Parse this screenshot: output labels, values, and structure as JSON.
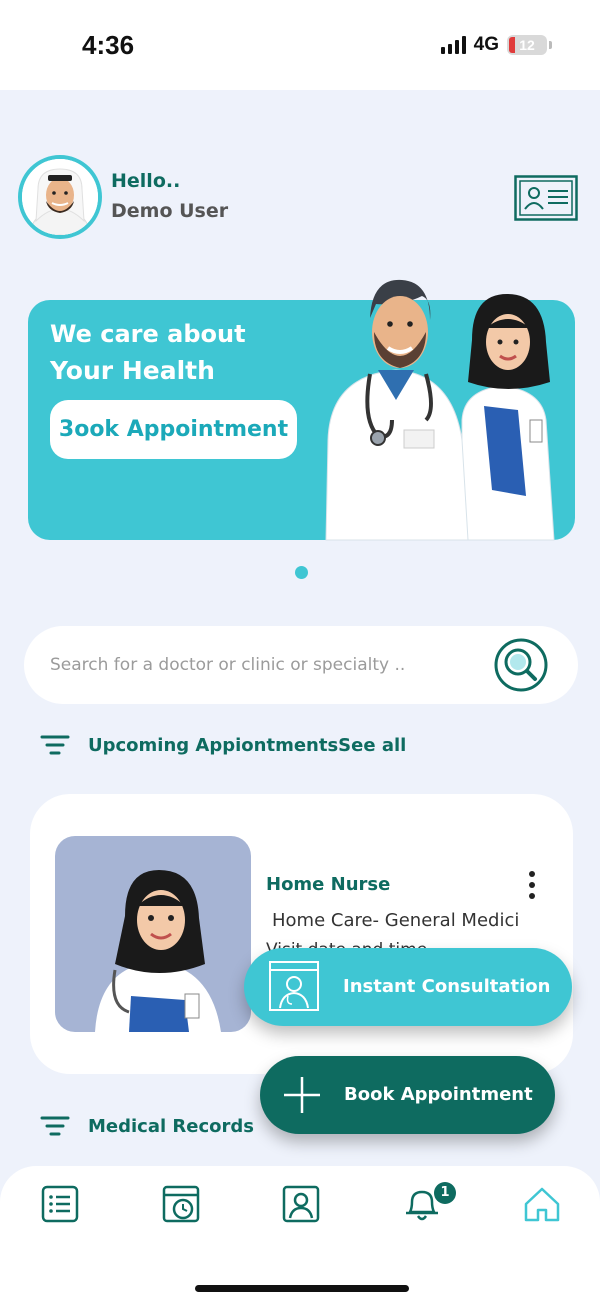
{
  "status": {
    "time": "4:36",
    "network": "4G",
    "battery": "12"
  },
  "greeting": {
    "hello": "Hello..",
    "name": "Demo User"
  },
  "banner": {
    "line1": "We care about",
    "line2": "Your Health",
    "button": "3ook Appointment"
  },
  "search": {
    "placeholder": "Search for a doctor or clinic or specialty .."
  },
  "sections": {
    "upcoming": "Upcoming AppiontmentsSee all",
    "records": "Medical Records"
  },
  "appointment": {
    "type": "Home Nurse",
    "service": "Home Care- General Medici",
    "extra": "Visit date and time"
  },
  "actions": {
    "instant": "Instant Consultation",
    "book": "Book Appointment"
  },
  "nav": {
    "notification_count": "1",
    "items": [
      "list-icon",
      "calendar-clock-icon",
      "profile-icon",
      "bell-icon",
      "home-icon"
    ]
  },
  "colors": {
    "primary": "#0e6b60",
    "accent": "#3fc6d3",
    "background": "#eef2fb"
  }
}
